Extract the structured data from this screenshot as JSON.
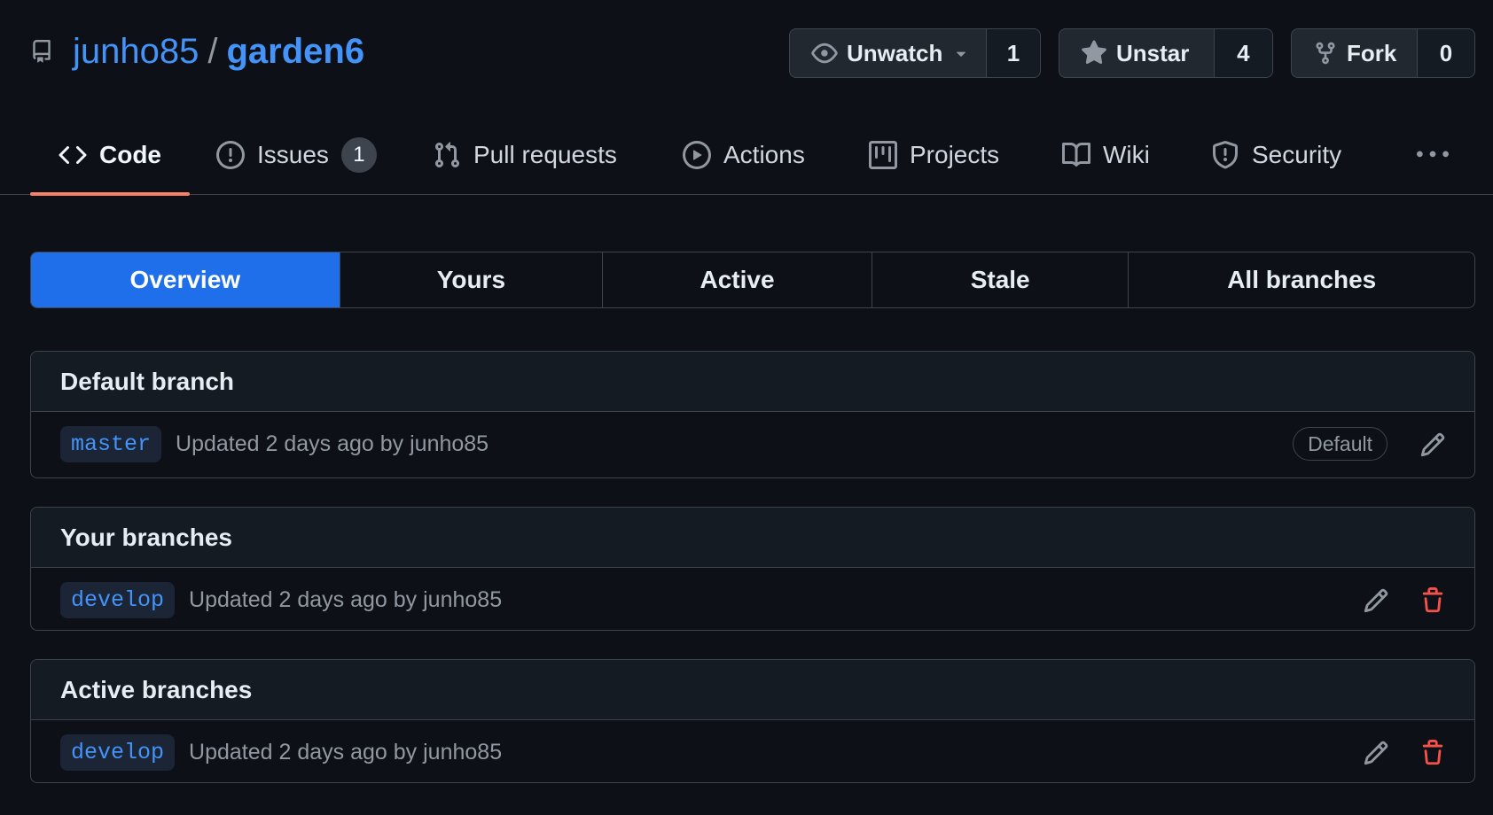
{
  "repo": {
    "owner": "junho85",
    "separator": "/",
    "name": "garden6",
    "icon": "repo-icon"
  },
  "actions": {
    "watch": {
      "label": "Unwatch",
      "count": "1",
      "icon": "eye-icon"
    },
    "star": {
      "label": "Unstar",
      "count": "4",
      "icon": "star-icon"
    },
    "fork": {
      "label": "Fork",
      "count": "0",
      "icon": "fork-icon"
    }
  },
  "tabs": [
    {
      "label": "Code",
      "icon": "code-icon",
      "selected": true
    },
    {
      "label": "Issues",
      "icon": "issue-icon",
      "counter": "1"
    },
    {
      "label": "Pull requests",
      "icon": "pull-request-icon"
    },
    {
      "label": "Actions",
      "icon": "play-icon"
    },
    {
      "label": "Projects",
      "icon": "project-icon"
    },
    {
      "label": "Wiki",
      "icon": "book-icon"
    },
    {
      "label": "Security",
      "icon": "shield-icon"
    }
  ],
  "subnav": [
    {
      "label": "Overview",
      "active": true
    },
    {
      "label": "Yours"
    },
    {
      "label": "Active"
    },
    {
      "label": "Stale"
    },
    {
      "label": "All branches"
    }
  ],
  "sections": {
    "default": {
      "title": "Default branch",
      "branch": "master",
      "updated": "Updated 2 days ago by",
      "user": "junho85",
      "badge": "Default"
    },
    "yours": {
      "title": "Your branches",
      "branch": "develop",
      "updated": "Updated 2 days ago by",
      "user": "junho85"
    },
    "active": {
      "title": "Active branches",
      "branch": "develop",
      "updated": "Updated 2 days ago by",
      "user": "junho85"
    }
  },
  "colors": {
    "background": "#0d1117",
    "accent": "#4493f8",
    "selected_tab_underline": "#f78166",
    "active_subnav": "#1f6feb",
    "delete": "#f85149"
  }
}
